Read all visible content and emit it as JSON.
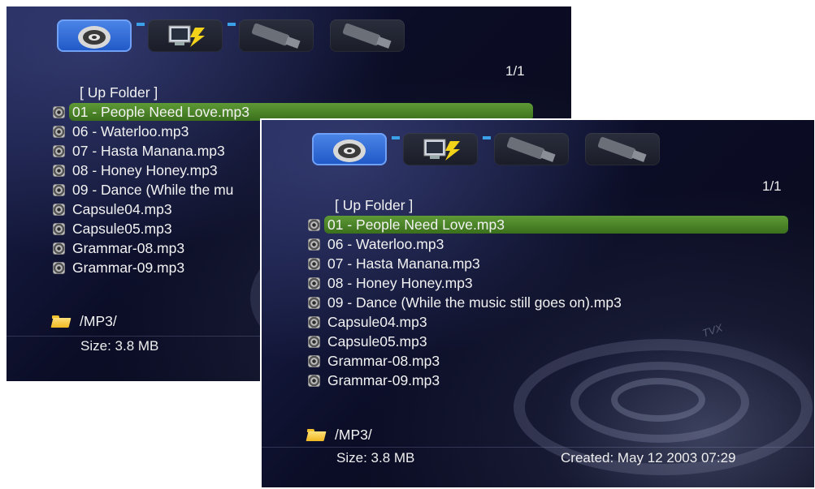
{
  "page_indicator": "1/1",
  "up_folder_label": "[ Up Folder ]",
  "files": [
    "01 - People Need Love.mp3",
    "06 - Waterloo.mp3",
    "07 - Hasta Manana.mp3",
    "08 - Honey Honey.mp3",
    "09 - Dance (While the music still goes on).mp3",
    "Capsule04.mp3",
    "Capsule05.mp3",
    "Grammar-08.mp3",
    "Grammar-09.mp3"
  ],
  "back_truncated_item": "09 - Dance (While the mu",
  "path": "/MP3/",
  "size_label": "Size:  3.8 MB",
  "created_label": "Created:  May 12 2003 07:29",
  "brand": "TVX",
  "tabs": [
    {
      "icon": "disc-icon",
      "active": true
    },
    {
      "icon": "network-pc-icon",
      "active": false
    },
    {
      "icon": "usb-icon",
      "active": false
    },
    {
      "icon": "usb-icon",
      "active": false
    }
  ],
  "colors": {
    "selection": "#4a8428",
    "active_tab": "#2f6ed6",
    "background": "#0d1030"
  }
}
